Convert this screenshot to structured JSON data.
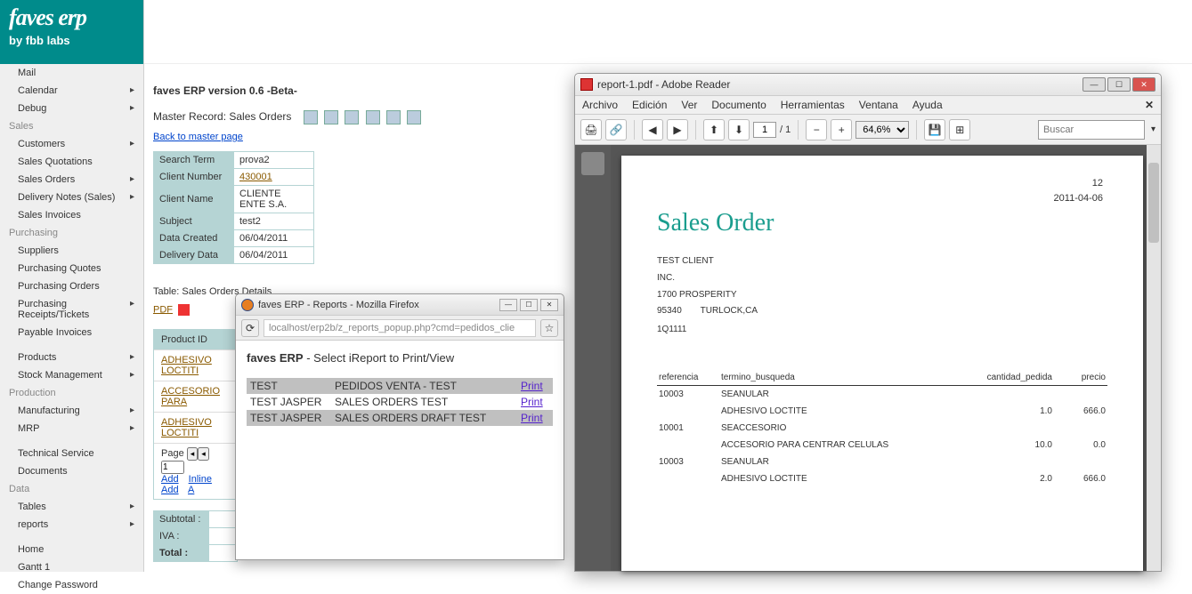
{
  "logo": {
    "big": "faves erp",
    "small": "by fbb labs"
  },
  "sidebar": {
    "items": [
      {
        "type": "item",
        "label": "Mail",
        "indent": 1,
        "sub": 0
      },
      {
        "type": "item",
        "label": "Calendar",
        "indent": 1,
        "sub": 1
      },
      {
        "type": "item",
        "label": "Debug",
        "indent": 1,
        "sub": 1
      },
      {
        "type": "header",
        "label": "Sales"
      },
      {
        "type": "item",
        "label": "Customers",
        "indent": 1,
        "sub": 1
      },
      {
        "type": "item",
        "label": "Sales Quotations",
        "indent": 1,
        "sub": 0
      },
      {
        "type": "item",
        "label": "Sales Orders",
        "indent": 1,
        "sub": 1
      },
      {
        "type": "item",
        "label": "Delivery Notes (Sales)",
        "indent": 1,
        "sub": 1
      },
      {
        "type": "item",
        "label": "Sales Invoices",
        "indent": 1,
        "sub": 0
      },
      {
        "type": "header",
        "label": "Purchasing"
      },
      {
        "type": "item",
        "label": "Suppliers",
        "indent": 1,
        "sub": 0
      },
      {
        "type": "item",
        "label": "Purchasing Quotes",
        "indent": 1,
        "sub": 0
      },
      {
        "type": "item",
        "label": "Purchasing Orders",
        "indent": 1,
        "sub": 0
      },
      {
        "type": "item",
        "label": "Purchasing Receipts/Tickets",
        "indent": 1,
        "sub": 1
      },
      {
        "type": "item",
        "label": "Payable Invoices",
        "indent": 1,
        "sub": 0
      },
      {
        "type": "div"
      },
      {
        "type": "item",
        "label": "Products",
        "indent": 1,
        "sub": 1
      },
      {
        "type": "item",
        "label": "Stock Management",
        "indent": 1,
        "sub": 1
      },
      {
        "type": "header",
        "label": "Production"
      },
      {
        "type": "item",
        "label": "Manufacturing",
        "indent": 1,
        "sub": 1
      },
      {
        "type": "item",
        "label": "MRP",
        "indent": 1,
        "sub": 1
      },
      {
        "type": "div"
      },
      {
        "type": "item",
        "label": "Technical Service",
        "indent": 1,
        "sub": 0
      },
      {
        "type": "item",
        "label": "Documents",
        "indent": 1,
        "sub": 0
      },
      {
        "type": "header",
        "label": "Data"
      },
      {
        "type": "item",
        "label": "Tables",
        "indent": 1,
        "sub": 1
      },
      {
        "type": "item",
        "label": "reports",
        "indent": 1,
        "sub": 1
      },
      {
        "type": "div"
      },
      {
        "type": "item",
        "label": "Home",
        "indent": 1,
        "sub": 0
      },
      {
        "type": "item",
        "label": "Gantt 1",
        "indent": 1,
        "sub": 0
      },
      {
        "type": "item",
        "label": "Change Password",
        "indent": 1,
        "sub": 0
      }
    ]
  },
  "main": {
    "title": "faves ERP version 0.6 -Beta-",
    "master": "Master Record: Sales Orders",
    "back": "Back to master page",
    "record": [
      {
        "k": "Search Term",
        "v": "prova2",
        "link": 0
      },
      {
        "k": "Client Number",
        "v": "430001",
        "link": 1
      },
      {
        "k": "Client Name",
        "v": "CLIENTE ENTE S.A.",
        "link": 0
      },
      {
        "k": "Subject",
        "v": "test2",
        "link": 0
      },
      {
        "k": "Data Created",
        "v": "06/04/2011",
        "link": 0
      },
      {
        "k": "Delivery Data",
        "v": "06/04/2011",
        "link": 0
      }
    ],
    "tbltitle": "Table: Sales Orders Details",
    "pdf": "PDF",
    "details_header": "Product ID",
    "detail_rows": [
      "ADHESIVO LOCTITI",
      "ACCESORIO PARA",
      "ADHESIVO LOCTITI"
    ],
    "pager": {
      "page": "Page",
      "pagenum": "1",
      "add": "Add",
      "inline": "Inline Add",
      "a": "A"
    },
    "totals": [
      {
        "k": "Subtotal :",
        "v": ""
      },
      {
        "k": "IVA :",
        "v": ""
      },
      {
        "k": "Total :",
        "v": ""
      }
    ]
  },
  "ff": {
    "title": "faves ERP - Reports - Mozilla Firefox",
    "url": "localhost/erp2b/z_reports_popup.php?cmd=pedidos_clie",
    "heading_b": "faves ERP",
    "heading_rest": " - Select iReport to Print/View",
    "rows": [
      {
        "a": "TEST",
        "b": "PEDIDOS VENTA - TEST",
        "c": "Print",
        "sel": 1
      },
      {
        "a": "TEST JASPER",
        "b": "SALES ORDERS TEST",
        "c": "Print",
        "sel": 0
      },
      {
        "a": "TEST JASPER",
        "b": "SALES ORDERS DRAFT TEST",
        "c": "Print",
        "sel": 1
      }
    ]
  },
  "adobe": {
    "title": "report-1.pdf - Adobe Reader",
    "menu": [
      "Archivo",
      "Edición",
      "Ver",
      "Documento",
      "Herramientas",
      "Ventana",
      "Ayuda"
    ],
    "page_current": "1",
    "page_total": "/ 1",
    "zoom": "64,6%",
    "search_ph": "Buscar",
    "doc": {
      "num": "12",
      "date": "2011-04-06",
      "h1": "Sales Order",
      "addr1": "TEST CLIENT",
      "addr2": "INC.",
      "addr3": "1700 PROSPERITY",
      "zip": "95340",
      "city": "TURLOCK,CA",
      "code": "1Q1111",
      "cols": [
        "referencia",
        "termino_busqueda",
        "cantidad_pedida",
        "precio"
      ],
      "lines": [
        {
          "ref": "10003",
          "term": "SEANULAR",
          "term2": "ADHESIVO LOCTITE",
          "qty": "1.0",
          "price": "666.0"
        },
        {
          "ref": "10001",
          "term": "SEACCESORIO",
          "term2": "ACCESORIO PARA CENTRAR CELULAS",
          "qty": "10.0",
          "price": "0.0"
        },
        {
          "ref": "10003",
          "term": "SEANULAR",
          "term2": "ADHESIVO LOCTITE",
          "qty": "2.0",
          "price": "666.0"
        }
      ]
    }
  }
}
